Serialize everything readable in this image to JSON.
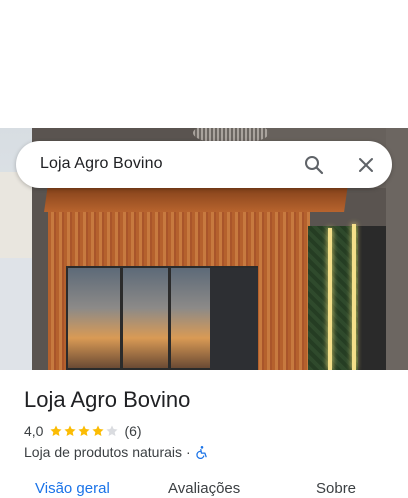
{
  "search": {
    "query": "Loja Agro Bovino"
  },
  "place": {
    "name": "Loja Agro Bovino",
    "rating": "4,0",
    "stars_filled": 4,
    "stars_total": 5,
    "review_count": "(6)",
    "category": "Loja de produtos naturais",
    "separator": "·"
  },
  "tabs": [
    {
      "label": "Visão geral",
      "active": true
    },
    {
      "label": "Avaliações",
      "active": false
    },
    {
      "label": "Sobre",
      "active": false
    }
  ],
  "colors": {
    "accent": "#1a73e8",
    "star": "#fbbc04",
    "star_empty": "#dadce0",
    "accessibility": "#1a73e8"
  },
  "icons": [
    "search-icon",
    "close-icon",
    "star-icon",
    "wheelchair-icon"
  ]
}
